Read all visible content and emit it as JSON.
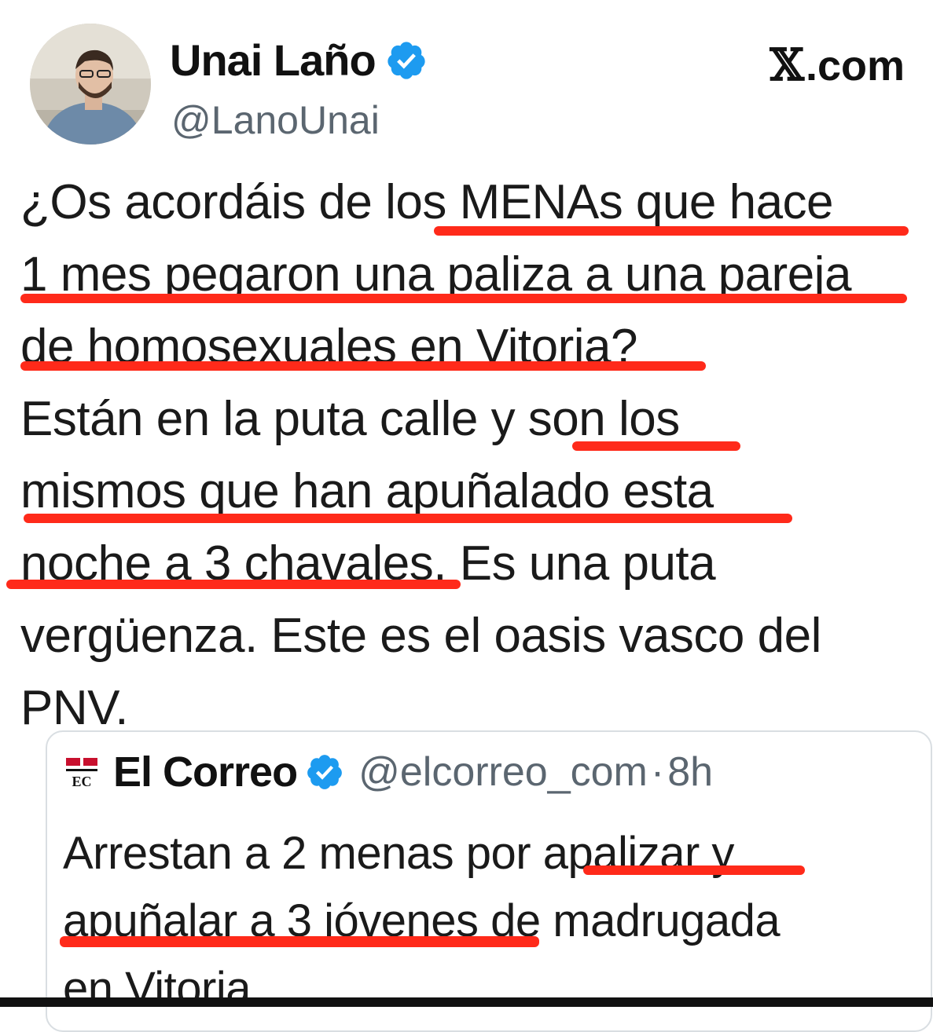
{
  "author": {
    "display_name": "Unai Laño",
    "handle": "@LanoUnai",
    "verified": true
  },
  "brand": {
    "x_glyph": "𝕏",
    "domain": ".com"
  },
  "tweet": {
    "lines": [
      "¿Os acordáis de los MENAs que hace",
      "1 mes pegaron una paliza a una pareja",
      "de homosexuales en Vitoria?",
      "Están en la puta calle y son los",
      "mismos que han apuñalado esta",
      "noche a 3 chavales. Es una puta",
      "vergüenza. Este es el oasis vasco del",
      "PNV."
    ]
  },
  "quoted": {
    "name": "El Correo",
    "handle": "@elcorreo_com",
    "separator": "·",
    "time": "8h",
    "verified": true,
    "logo_text": "EC",
    "lines": [
      "Arrestan a 2 menas por apalizar y",
      "apuñalar a 3 jóvenes de madrugada",
      "en Vitoria"
    ]
  },
  "colors": {
    "underline": "#ff2a1a",
    "verified_badge": "#1d9bf0",
    "secondary_text": "#5b6670"
  },
  "icons": [
    "avatar-photo",
    "verified-badge-icon",
    "x-logo-icon",
    "el-correo-logo-icon"
  ]
}
